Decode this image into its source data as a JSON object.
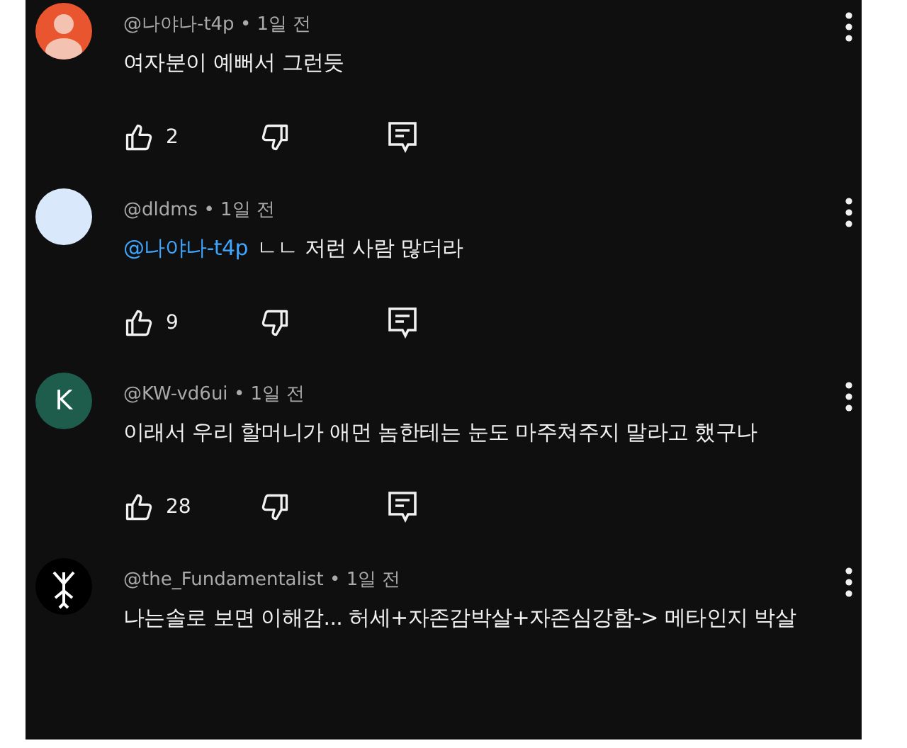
{
  "comments": [
    {
      "author": "@나야나-t4p",
      "separator": "•",
      "time": "1일 전",
      "avatar": {
        "kind": "person",
        "color": "#e8552f"
      },
      "text": "여자분이 예뻐서 그런듯",
      "actions": {
        "likes": "2"
      }
    },
    {
      "author": "@dldms",
      "separator": "•",
      "time": "1일 전",
      "avatar": {
        "kind": "plain",
        "color": "#d9e8fb"
      },
      "mention": "@나야나-t4p",
      "text": "ㄴㄴ 저런 사람 많더라",
      "actions": {
        "likes": "9"
      }
    },
    {
      "author": "@KW-vd6ui",
      "separator": "•",
      "time": "1일 전",
      "avatar": {
        "kind": "letter",
        "color": "#1e5c4c",
        "letter": "K"
      },
      "text": "이래서 우리 할머니가 애먼 놈한테는 눈도 마주쳐주지 말라고 했구나",
      "actions": {
        "likes": "28"
      }
    },
    {
      "author": "@the_Fundamentalist",
      "separator": "•",
      "time": "1일 전",
      "avatar": {
        "kind": "symbol",
        "color": "#000000"
      },
      "text": "나는솔로 보면 이해감... 허세+자존감박살+자존심강함-> 메타인지 박살"
    }
  ]
}
